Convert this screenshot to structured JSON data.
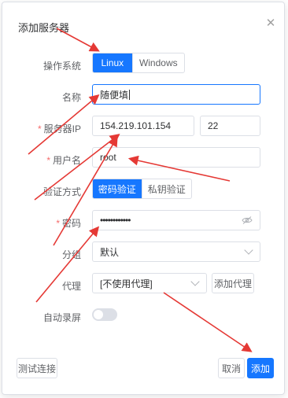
{
  "dialog": {
    "title": "添加服务器",
    "close_icon": "close-icon"
  },
  "os": {
    "label": "操作系统",
    "options": [
      "Linux",
      "Windows"
    ],
    "selected": "Linux"
  },
  "name": {
    "label": "名称",
    "value": "随便填"
  },
  "server_ip": {
    "label": "服务器IP",
    "value": "154.219.101.154",
    "port": "22"
  },
  "username": {
    "label": "用户名",
    "value": "root"
  },
  "auth": {
    "label": "验证方式",
    "options": [
      "密码验证",
      "私钥验证"
    ],
    "selected": "密码验证"
  },
  "password": {
    "label": "密码",
    "value": "••••••••••••",
    "eye_icon": "eye-off-icon"
  },
  "group": {
    "label": "分组",
    "value": "默认"
  },
  "proxy": {
    "label": "代理",
    "value": "[不使用代理]",
    "add_label": "添加代理"
  },
  "auto_record": {
    "label": "自动录屏",
    "enabled": false
  },
  "footer": {
    "test_label": "测试连接",
    "cancel_label": "取消",
    "add_label": "添加"
  },
  "colors": {
    "primary": "#1677ff",
    "required": "#f56c6c",
    "annotation": "#e53935"
  }
}
